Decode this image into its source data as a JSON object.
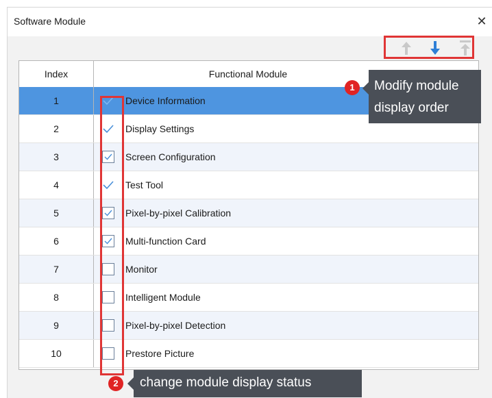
{
  "window": {
    "title": "Software Module",
    "close_glyph": "✕"
  },
  "order_buttons": [
    {
      "icon": "move-up-icon",
      "enabled": false
    },
    {
      "icon": "move-down-icon",
      "enabled": true
    },
    {
      "icon": "move-to-top-icon",
      "enabled": false
    }
  ],
  "table": {
    "columns": [
      "Index",
      "Functional Module"
    ],
    "rows": [
      {
        "index": "1",
        "name": "Device Information",
        "checked": true,
        "locked": true,
        "selected": true
      },
      {
        "index": "2",
        "name": "Display Settings",
        "checked": true,
        "locked": true
      },
      {
        "index": "3",
        "name": "Screen Configuration",
        "checked": true,
        "locked": false
      },
      {
        "index": "4",
        "name": "Test Tool",
        "checked": true,
        "locked": true
      },
      {
        "index": "5",
        "name": "Pixel-by-pixel Calibration",
        "checked": true,
        "locked": false
      },
      {
        "index": "6",
        "name": "Multi-function Card",
        "checked": true,
        "locked": false
      },
      {
        "index": "7",
        "name": "Monitor",
        "checked": false,
        "locked": false
      },
      {
        "index": "8",
        "name": "Intelligent Module",
        "checked": false,
        "locked": false
      },
      {
        "index": "9",
        "name": "Pixel-by-pixel Detection",
        "checked": false,
        "locked": false
      },
      {
        "index": "10",
        "name": "Prestore Picture",
        "checked": false,
        "locked": false
      }
    ]
  },
  "annotations": {
    "order": {
      "badge": "1",
      "line1": "Modify module",
      "line2": "display order"
    },
    "status": {
      "badge": "2",
      "text": "change module display status"
    }
  },
  "colors": {
    "highlight_red": "#e03535",
    "selected_row": "#4e95e0",
    "arrow_active": "#2f7fd6",
    "arrow_disabled": "#c9c9c9",
    "callout_bg": "#4a4f57"
  }
}
